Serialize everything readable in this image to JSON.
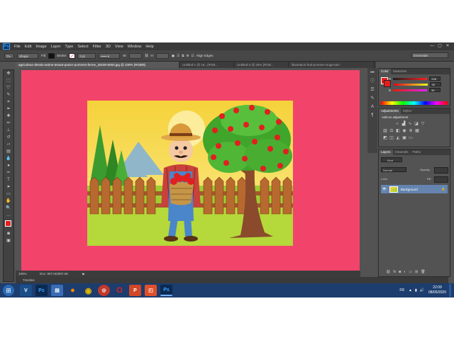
{
  "menubar": {
    "logo": "Ps",
    "items": [
      "File",
      "Edit",
      "Image",
      "Layer",
      "Type",
      "Select",
      "Filter",
      "3D",
      "View",
      "Window",
      "Help"
    ],
    "controls": [
      "—",
      "▢",
      "✕"
    ]
  },
  "options": {
    "tool_mode": "Shape",
    "fill_label": "Fill:",
    "stroke_label": "Stroke:",
    "stroke_size": "3 pt",
    "w_label": "W:",
    "h_label": "H:",
    "align_edges": "Align Edges",
    "workspace": "Essentials"
  },
  "tabs": [
    {
      "label": "agriculteur-dessin-anime-tenant-panier-pommes-ferme_29190-5083.jpg @ 100% (RGB/8)",
      "active": true
    },
    {
      "label": "Untitled-1 @ 16...(RGB...",
      "active": false
    },
    {
      "label": "Untitled-2 @ 25% (RGB...",
      "active": false
    },
    {
      "label": "illustration-fruit-pomme-rouge-tam",
      "active": false
    }
  ],
  "status": {
    "zoom": "100%",
    "doc": "Doc: 907.0K/907.0K"
  },
  "timeline": "Timeline",
  "color_panel": {
    "tabs": [
      "Color",
      "Swatches"
    ],
    "channels": [
      {
        "label": "R",
        "value": "228"
      },
      {
        "label": "G",
        "value": "30"
      },
      {
        "label": "B",
        "value": "30"
      }
    ]
  },
  "adjustments_panel": {
    "tabs": [
      "Adjustments",
      "Styles"
    ],
    "heading": "Add an adjustment"
  },
  "layers_panel": {
    "tabs": [
      "Layers",
      "Channels",
      "Paths"
    ],
    "kind": "Kind",
    "blend_mode": "Normal",
    "opacity_label": "Opacity:",
    "lock_label": "Lock:",
    "fill_label": "Fill:",
    "layer_name": "Background"
  },
  "taskbar": {
    "lang": "FR",
    "time": "22:09",
    "date": "08/05/2020"
  },
  "colors": {
    "canvas_bg": "#f2446a",
    "foreground": "#e41e1e",
    "background": "#ffffff",
    "selected_layer": "#6585b0",
    "taskbar": "#1c3d6e"
  }
}
